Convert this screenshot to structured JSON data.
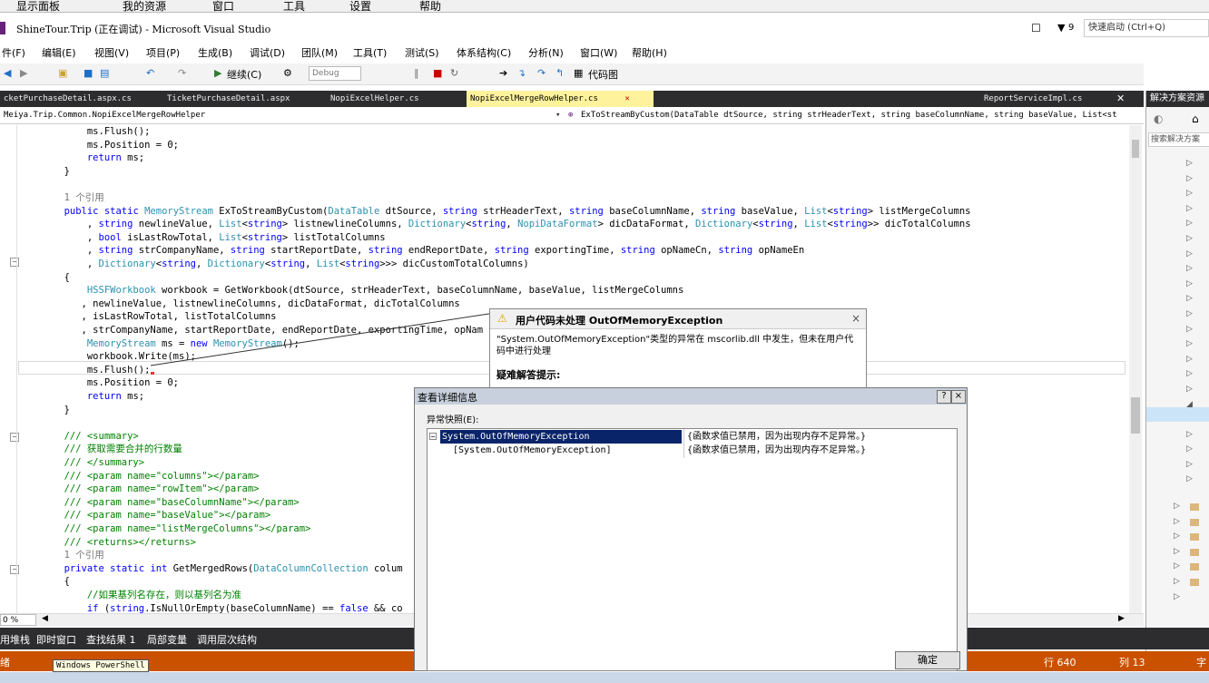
{
  "outer_bar": {
    "items": [
      "显示面板",
      "我的资源",
      "窗口",
      "工具",
      "设置",
      "帮助"
    ]
  },
  "title": {
    "app_title": "ShineTour.Trip (正在调试) - Microsoft Visual Studio",
    "notifications": "9",
    "quick_launch_placeholder": "快速启动 (Ctrl+Q)"
  },
  "menu": [
    "件(F)",
    "编辑(E)",
    "视图(V)",
    "项目(P)",
    "生成(B)",
    "调试(D)",
    "团队(M)",
    "工具(T)",
    "测试(S)",
    "体系结构(C)",
    "分析(N)",
    "窗口(W)",
    "帮助(H)"
  ],
  "toolbar": {
    "continue_label": "继续(C)",
    "config": "Debug",
    "codemap": "代码图"
  },
  "tabs": [
    {
      "label": "cketPurchaseDetail.aspx.cs",
      "active": false
    },
    {
      "label": "TicketPurchaseDetail.aspx",
      "active": false
    },
    {
      "label": "NopiExcelHelper.cs",
      "active": false
    },
    {
      "label": "NopiExcelMergeRowHelper.cs",
      "active": true
    },
    {
      "label": "ReportServiceImpl.cs",
      "active": false
    }
  ],
  "nav": {
    "left": "Meiya.Trip.Common.NopiExcelMergeRowHelper",
    "right": "ExToStreamByCustom(DataTable dtSource, string strHeaderText, string baseColumnName, string baseValue, List<st"
  },
  "code": [
    "            ms.Flush();",
    "            ms.Position = 0;",
    "            return ms;",
    "        }",
    "",
    "        1 个引用",
    "        public static MemoryStream ExToStreamByCustom(DataTable dtSource, string strHeaderText, string baseColumnName, string baseValue, List<string> listMergeColumns",
    "            , string newlineValue, List<string> listnewlineColumns, Dictionary<string, NopiDataFormat> dicDataFormat, Dictionary<string, List<string>> dicTotalColumns",
    "            , bool isLastRowTotal, List<string> listTotalColumns",
    "            , string strCompanyName, string startReportDate, string endReportDate, string exportingTime, string opNameCn, string opNameEn",
    "            , Dictionary<string, Dictionary<string, List<string>>> dicCustomTotalColumns)",
    "        {",
    "            HSSFWorkbook workbook = GetWorkbook(dtSource, strHeaderText, baseColumnName, baseValue, listMergeColumns",
    "           , newlineValue, listnewlineColumns, dicDataFormat, dicTotalColumns",
    "           , isLastRowTotal, listTotalColumns",
    "           , strCompanyName, startReportDate, endReportDate, exportingTime, opNam",
    "            MemoryStream ms = new MemoryStream();",
    "            workbook.Write(ms);",
    "            ms.Flush();",
    "            ms.Position = 0;",
    "            return ms;",
    "        }",
    "",
    "        /// <summary>",
    "        /// 获取需要合并的行数量",
    "        /// </summary>",
    "        /// <param name=\"columns\"></param>",
    "        /// <param name=\"rowItem\"></param>",
    "        /// <param name=\"baseColumnName\"></param>",
    "        /// <param name=\"baseValue\"></param>",
    "        /// <param name=\"listMergeColumns\"></param>",
    "        /// <returns></returns>",
    "        1 个引用",
    "        private static int GetMergedRows(DataColumnCollection colum",
    "        {",
    "            //如果基列名存在，则以基列名为准",
    "            if (string.IsNullOrEmpty(baseColumnName) == false && co"
  ],
  "exception": {
    "title": "用户代码未处理 OutOfMemoryException",
    "message": "\"System.OutOfMemoryException\"类型的异常在 mscorlib.dll 中发生，但未在用户代码中进行处理",
    "hint_header": "疑难解答提示:"
  },
  "detail": {
    "title": "查看详细信息",
    "label": "异常快照(E):",
    "rows": [
      {
        "name": "System.OutOfMemoryException",
        "value": "{函数求值已禁用，因为出现内存不足异常。}"
      },
      {
        "name": "[System.OutOfMemoryException]",
        "value": "{函数求值已禁用，因为出现内存不足异常。}"
      }
    ],
    "ok": "确定",
    "help": "?",
    "close": "×"
  },
  "zoom": "0 %",
  "bottom_tabs": [
    "用堆栈",
    "即时窗口",
    "查找结果 1",
    "局部变量",
    "调用层次结构"
  ],
  "status": {
    "left": "绪",
    "line": "行 640",
    "col": "列 13",
    "ch": "字"
  },
  "taskbar_tooltip": "Windows PowerShell",
  "solution": {
    "title": "解决方案资源",
    "search": "搜索解决方案"
  }
}
